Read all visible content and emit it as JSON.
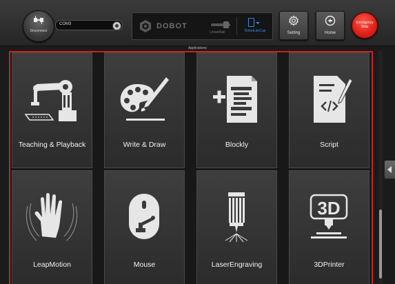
{
  "topbar": {
    "disconnect_label": "Disconnect",
    "port_value": "COM3",
    "logo_text": "DOBOT",
    "linear_rail_label": "LinearRail",
    "device_label": "DobotLiteCup",
    "setting_label": "Setting",
    "home_label": "Home",
    "estop_line1": "Emergency",
    "estop_line2": "Stop"
  },
  "applications_caption": "Applications",
  "apps": [
    {
      "label": "Teaching & Playback",
      "icon": "robot-arm-icon"
    },
    {
      "label": "Write & Draw",
      "icon": "palette-brush-icon"
    },
    {
      "label": "Blockly",
      "icon": "blockly-document-icon"
    },
    {
      "label": "Script",
      "icon": "script-code-icon"
    },
    {
      "label": "LeapMotion",
      "icon": "hand-icon"
    },
    {
      "label": "Mouse",
      "icon": "mouse-icon"
    },
    {
      "label": "LaserEngraving",
      "icon": "laser-icon"
    },
    {
      "label": "3DPrinter",
      "icon": "3d-printer-icon"
    }
  ],
  "printer_icon_text": "3D",
  "colors": {
    "accent_red": "#d31f24",
    "estop_red": "#e0221a",
    "device_blue": "#3b8be8",
    "tile_bg": "#3a3a3a"
  }
}
